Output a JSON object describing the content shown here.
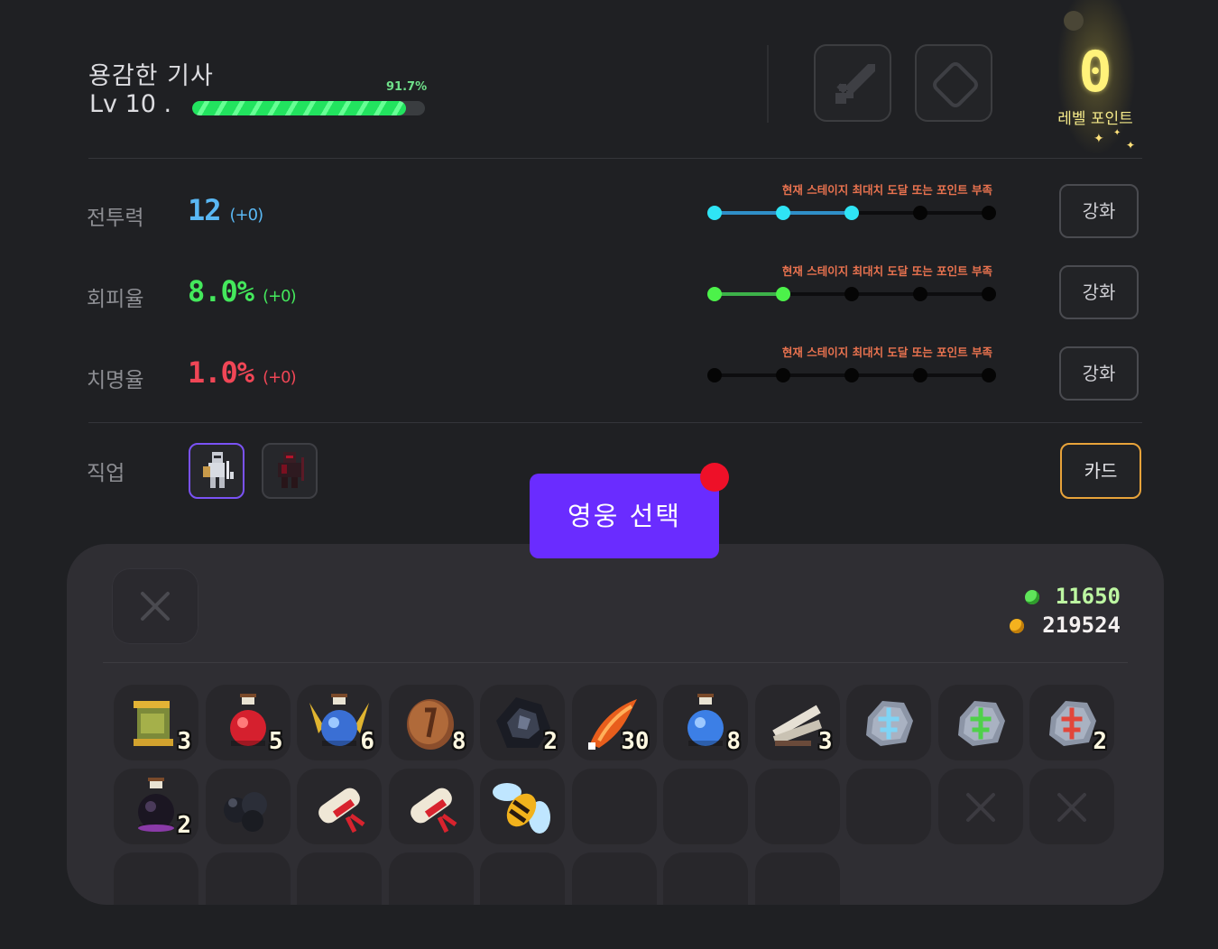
{
  "hero": {
    "name": "용감한 기사",
    "level_text": "Lv 10 .",
    "xp_percent_text": "91.7%",
    "xp_fraction": 0.917
  },
  "equipment_slots": [
    {
      "icon": "sword-icon"
    },
    {
      "icon": "diamond-outline-icon"
    }
  ],
  "level_points": {
    "value": "0",
    "label": "레벨 포인트"
  },
  "stats": [
    {
      "label": "전투력",
      "value": "12",
      "bonus": "(+0)",
      "color": "#5ab8f4",
      "bonus_color": "#5ab8f4",
      "track_color": "#2f8fc8",
      "node_color": "#2fe4f5",
      "filled": 3,
      "total": 5,
      "warning": "현재 스테이지 최대치 도달 또는 포인트 부족",
      "button": "강화"
    },
    {
      "label": "회피율",
      "value": "8.0%",
      "bonus": "(+0)",
      "color": "#44e85c",
      "bonus_color": "#44e85c",
      "track_color": "#3db24a",
      "node_color": "#4cf24a",
      "filled": 2,
      "total": 5,
      "warning": "현재 스테이지 최대치 도달 또는 포인트 부족",
      "button": "강화"
    },
    {
      "label": "치명율",
      "value": "1.0%",
      "bonus": "(+0)",
      "color": "#f04656",
      "bonus_color": "#f04656",
      "track_color": "#000000",
      "node_color": "#050505",
      "filled": 0,
      "total": 5,
      "warning": "현재 스테이지 최대치 도달 또는 포인트 부족",
      "button": "강화"
    }
  ],
  "job": {
    "label": "직업",
    "classes": [
      {
        "icon": "knight-class-icon",
        "selected": true
      },
      {
        "icon": "dark-knight-class-icon",
        "selected": false
      }
    ],
    "card_button": "카드"
  },
  "hero_select_button": "영웅 선택",
  "currency": {
    "gems": "11650",
    "gold": "219524",
    "gem_color": "#5fe55a",
    "gold_color": "#f4b21e"
  },
  "inventory": {
    "rows": [
      [
        {
          "icon": "oil-lamp-icon",
          "qty": "3"
        },
        {
          "icon": "red-potion-icon",
          "qty": "5"
        },
        {
          "icon": "blue-winged-potion-icon",
          "qty": "6"
        },
        {
          "icon": "bronze-coin-icon",
          "qty": "8"
        },
        {
          "icon": "black-ore-icon",
          "qty": "2"
        },
        {
          "icon": "fire-feather-icon",
          "qty": "30"
        },
        {
          "icon": "blue-potion-icon",
          "qty": "8"
        },
        {
          "icon": "bones-icon",
          "qty": "3"
        },
        {
          "icon": "blue-rune-stone-icon",
          "qty": ""
        },
        {
          "icon": "green-rune-stone-icon",
          "qty": ""
        },
        {
          "icon": "red-rune-stone-icon",
          "qty": "2"
        }
      ],
      [
        {
          "icon": "dark-potion-icon",
          "qty": "2"
        },
        {
          "icon": "coal-icon",
          "qty": ""
        },
        {
          "icon": "scroll-icon",
          "qty": ""
        },
        {
          "icon": "scroll-icon",
          "qty": ""
        },
        {
          "icon": "bee-icon",
          "qty": ""
        },
        {
          "icon": "",
          "qty": ""
        },
        {
          "icon": "",
          "qty": ""
        },
        {
          "icon": "",
          "qty": ""
        },
        {
          "icon": "",
          "qty": ""
        },
        {
          "icon": "locked-x-icon",
          "qty": ""
        },
        {
          "icon": "locked-x-icon",
          "qty": ""
        }
      ]
    ]
  }
}
